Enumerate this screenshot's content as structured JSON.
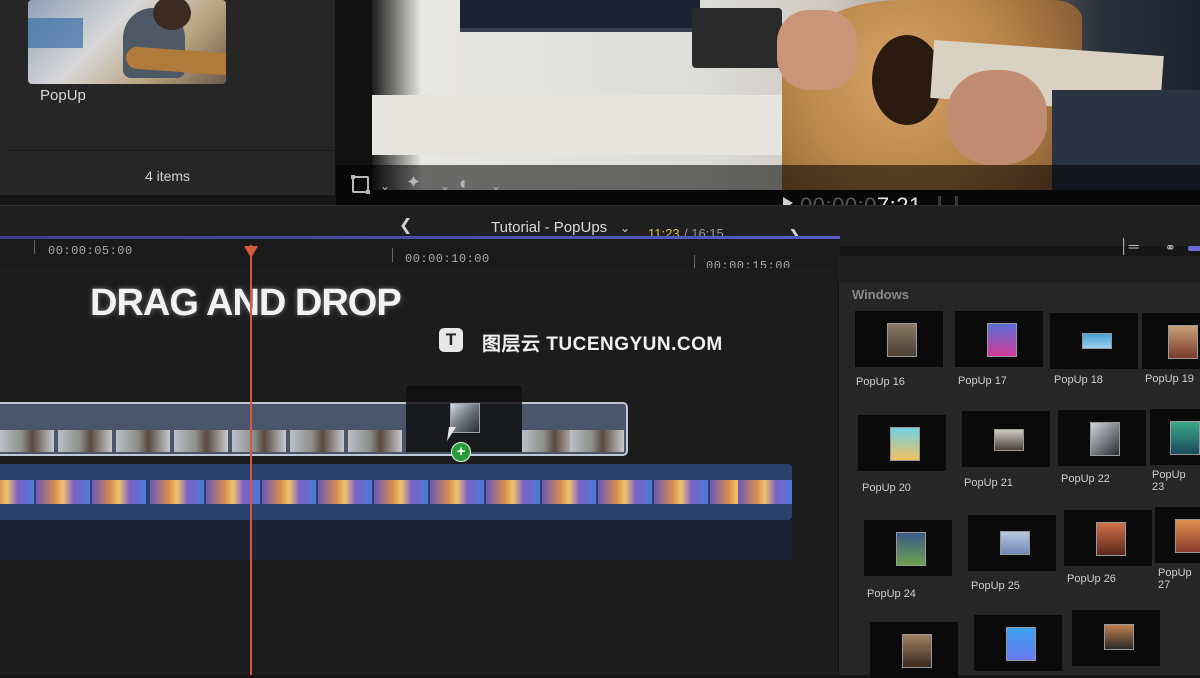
{
  "browser": {
    "clip_name": "PopUp",
    "item_count": "4 items"
  },
  "viewer": {
    "timecode_dim": "00:00:0",
    "timecode_lit": "7:21"
  },
  "timeline": {
    "project_name": "Tutorial - PopUps",
    "duration_current": "11:23",
    "duration_total": "/ 16:15",
    "ruler_labels": [
      "00:00:05:00",
      "00:00:10:00",
      "00:00:15:00"
    ],
    "title_overlay": "DRAG AND DROP",
    "accent_colors": {
      "playhead": "#d45a3a",
      "duration": "#d6c24a",
      "range_bar": "#5a5bc4",
      "add_badge": "#2a9d3a"
    }
  },
  "windows_browser": {
    "title": "Windows",
    "items": [
      {
        "label": "PopUp 16"
      },
      {
        "label": "PopUp 17"
      },
      {
        "label": "PopUp 18"
      },
      {
        "label": "PopUp 19"
      },
      {
        "label": "PopUp 20"
      },
      {
        "label": "PopUp 21"
      },
      {
        "label": "PopUp 22"
      },
      {
        "label": "PopUp 23"
      },
      {
        "label": "PopUp 24"
      },
      {
        "label": "PopUp 25"
      },
      {
        "label": "PopUp 26"
      },
      {
        "label": "PopUp 27"
      }
    ]
  },
  "watermark": {
    "logo": "T",
    "text": "图层云  TUCENGYUN.COM"
  },
  "icons": [
    "transform-icon",
    "enhance-wand-icon",
    "retime-icon",
    "play-icon",
    "back-arrow-icon",
    "forward-arrow-icon",
    "skimming-icon",
    "audio-skimming-icon",
    "add-icon",
    "cursor-icon"
  ]
}
